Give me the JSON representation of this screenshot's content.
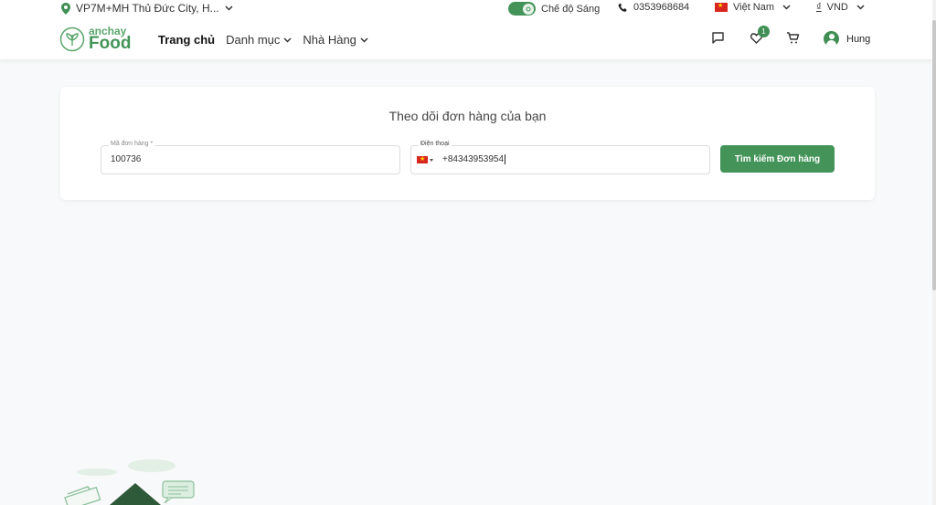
{
  "topbar": {
    "location": "VP7M+MH Thủ Đức City, H...",
    "mode_label": "Chế độ Sáng",
    "phone": "0353968684",
    "country": "Việt Nam",
    "currency_symbol": "₫",
    "currency": "VND"
  },
  "nav": {
    "logo_small": "anchay",
    "logo_big": "Food",
    "menu": [
      "Trang chủ",
      "Danh mục",
      "Nhà Hàng"
    ],
    "wishlist_count": "1",
    "user_name": "Hung"
  },
  "tracking": {
    "title": "Theo dõi đơn hàng của bạn",
    "order_label": "Mã đơn hàng *",
    "order_value": "100736",
    "phone_label": "Điện thoại",
    "phone_value": "+84343953954",
    "button_label": "Tìm kiếm Đơn hàng"
  },
  "colors": {
    "accent": "#44945a",
    "flag_red": "#d8261f"
  },
  "icons": [
    "location-pin-icon",
    "chevron-down-icon",
    "theme-toggle-icon",
    "phone-icon",
    "vietnam-flag-icon",
    "chat-icon",
    "heart-icon",
    "cart-icon",
    "user-avatar-icon"
  ]
}
